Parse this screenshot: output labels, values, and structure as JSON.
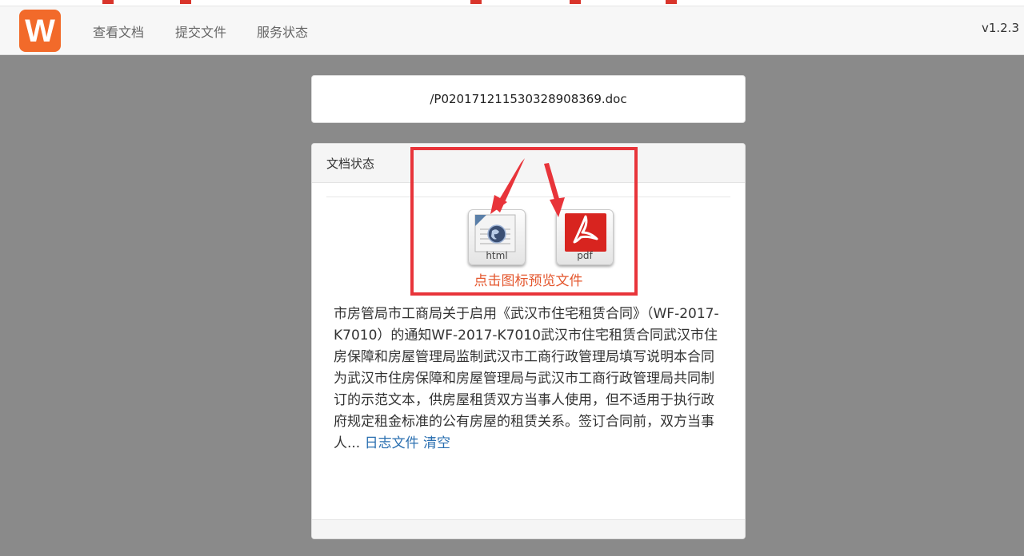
{
  "navbar": {
    "logo_letter": "W",
    "items": [
      "查看文档",
      "提交文件",
      "服务状态"
    ],
    "version": "v1.2.3"
  },
  "file": {
    "path": "/P020171211530328908369.doc"
  },
  "status": {
    "header": "文档状态",
    "html_label": "html",
    "pdf_label": "pdf",
    "preview_hint": "点击图标预览文件",
    "description": "市房管局市工商局关于启用《武汉市住宅租赁合同》（WF-2017-K7010）的通知WF-2017-K7010武汉市住宅租赁合同武汉市住房保障和房屋管理局监制武汉市工商行政管理局填写说明本合同为武汉市住房保障和房屋管理局与武汉市工商行政管理局共同制订的示范文本，供房屋租赁双方当事人使用，但不适用于执行政府规定租金标准的公有房屋的租赁关系。签订合同前，双方当事人... ",
    "log_link": "日志文件",
    "clear_link": "清空"
  },
  "colors": {
    "logo_bg": "#f26a2a",
    "annotation": "#e8343a",
    "hint": "#e4572e",
    "link": "#2a6fb0",
    "page_bg": "#8a8a8a"
  },
  "icons": [
    "html-file-icon",
    "pdf-file-icon"
  ]
}
